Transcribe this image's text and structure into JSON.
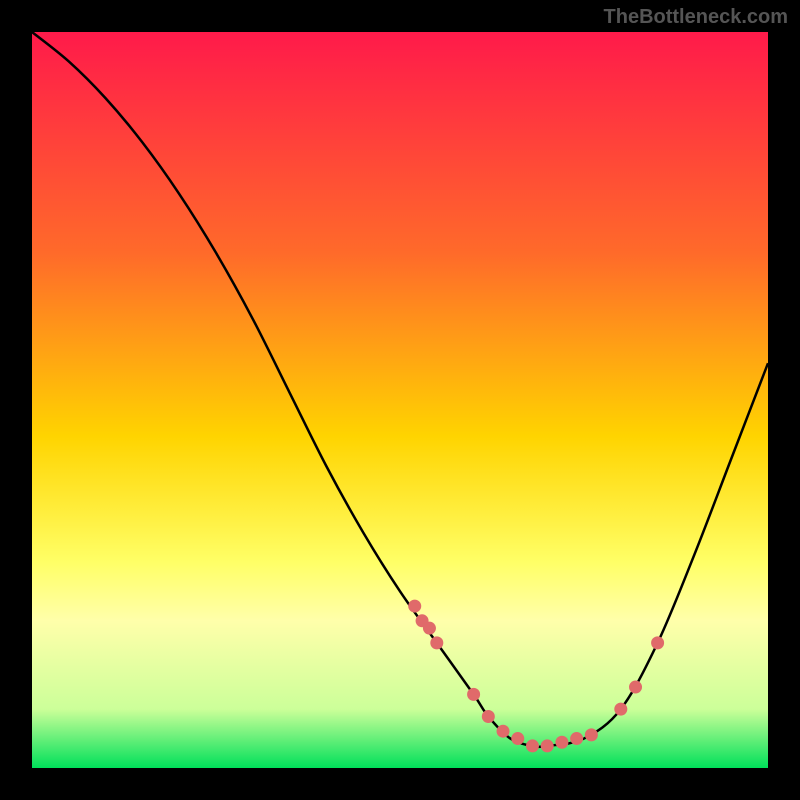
{
  "watermark": "TheBottleneck.com",
  "chart_data": {
    "type": "line",
    "title": "",
    "xlabel": "",
    "ylabel": "",
    "xlim": [
      0,
      100
    ],
    "ylim": [
      0,
      100
    ],
    "grid": false,
    "legend": false,
    "gradient_stops": [
      {
        "offset": 0,
        "color": "#ff1a4a"
      },
      {
        "offset": 30,
        "color": "#ff6a2a"
      },
      {
        "offset": 55,
        "color": "#ffd400"
      },
      {
        "offset": 72,
        "color": "#ffff66"
      },
      {
        "offset": 80,
        "color": "#ffffaa"
      },
      {
        "offset": 92,
        "color": "#ccff99"
      },
      {
        "offset": 100,
        "color": "#00e05a"
      }
    ],
    "series": [
      {
        "name": "bottleneck-curve",
        "x": [
          0,
          5,
          10,
          15,
          20,
          25,
          30,
          35,
          40,
          45,
          50,
          55,
          60,
          62,
          65,
          68,
          70,
          75,
          80,
          85,
          90,
          95,
          100
        ],
        "y": [
          100,
          96,
          91,
          85,
          78,
          70,
          61,
          51,
          41,
          32,
          24,
          17,
          10,
          7,
          4,
          3,
          3,
          4,
          8,
          17,
          29,
          42,
          55
        ]
      }
    ],
    "markers": {
      "name": "highlight-points",
      "color": "#e06a6a",
      "x": [
        52,
        53,
        54,
        55,
        60,
        62,
        64,
        66,
        68,
        70,
        72,
        74,
        76,
        80,
        82,
        85
      ],
      "y": [
        22,
        20,
        19,
        17,
        10,
        7,
        5,
        4,
        3,
        3,
        3.5,
        4,
        4.5,
        8,
        11,
        17
      ]
    }
  }
}
